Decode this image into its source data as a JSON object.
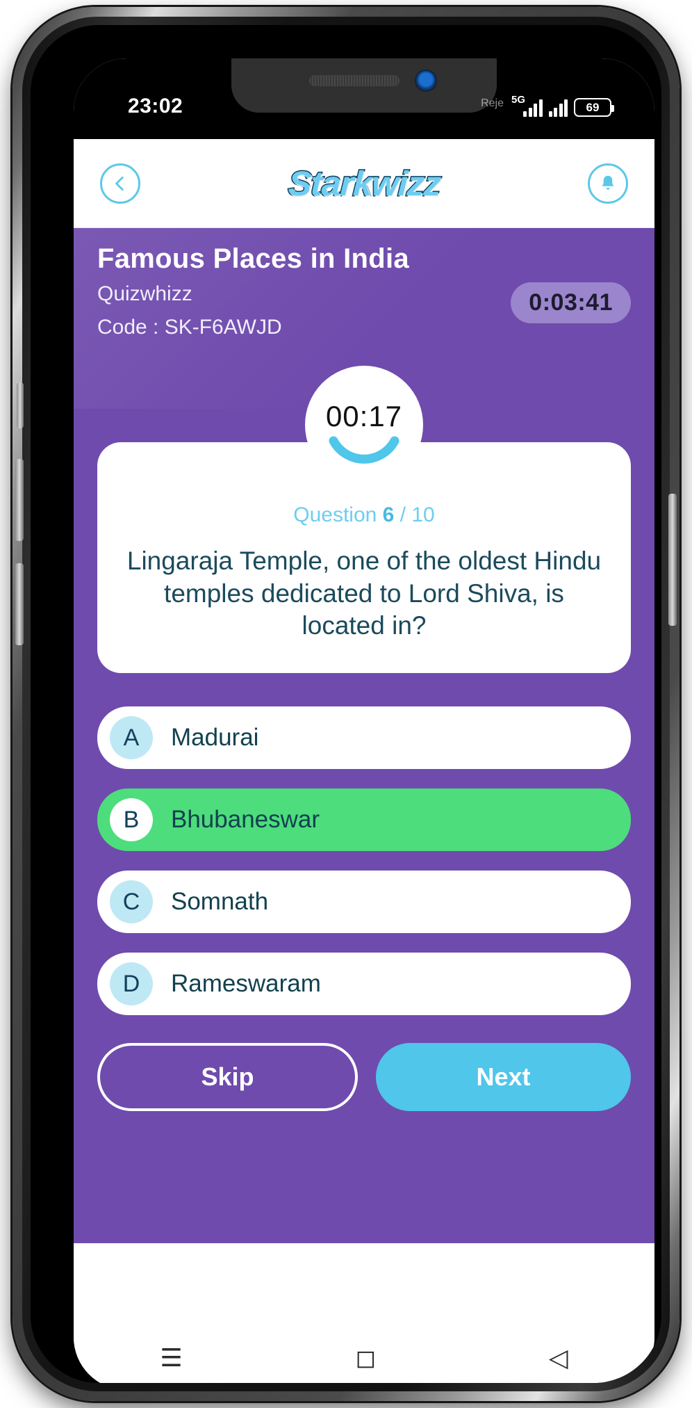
{
  "status_bar": {
    "time": "23:02",
    "carrier": "Reje",
    "network": "5G",
    "battery_level": "69"
  },
  "app_header": {
    "back_icon": "chevron-left-icon",
    "logo_text": "Starkwizz",
    "notification_icon": "bell-icon"
  },
  "quiz": {
    "title": "Famous Places in India",
    "host": "Quizwhizz",
    "code_label": "Code : SK-F6AWJD",
    "total_time": "0:03:41",
    "countdown": "00:17",
    "counter_prefix": "Question",
    "counter_current": "6",
    "counter_separator": "/",
    "counter_total": "10",
    "question_text": "Lingaraja Temple, one of the oldest Hindu temples dedicated to Lord Shiva, is located in?",
    "options": [
      {
        "letter": "A",
        "label": "Madurai",
        "selected": false
      },
      {
        "letter": "B",
        "label": "Bhubaneswar",
        "selected": true
      },
      {
        "letter": "C",
        "label": "Somnath",
        "selected": false
      },
      {
        "letter": "D",
        "label": "Rameswaram",
        "selected": false
      }
    ],
    "skip_label": "Skip",
    "next_label": "Next"
  },
  "nav_bar": {
    "recents_icon": "☰",
    "home_icon": "◻",
    "back_icon": "◁"
  },
  "colors": {
    "purple": "#6f4bad",
    "accent_blue": "#4fc6ea",
    "correct_green": "#4ddd7c",
    "dark_navy": "#13405c"
  }
}
